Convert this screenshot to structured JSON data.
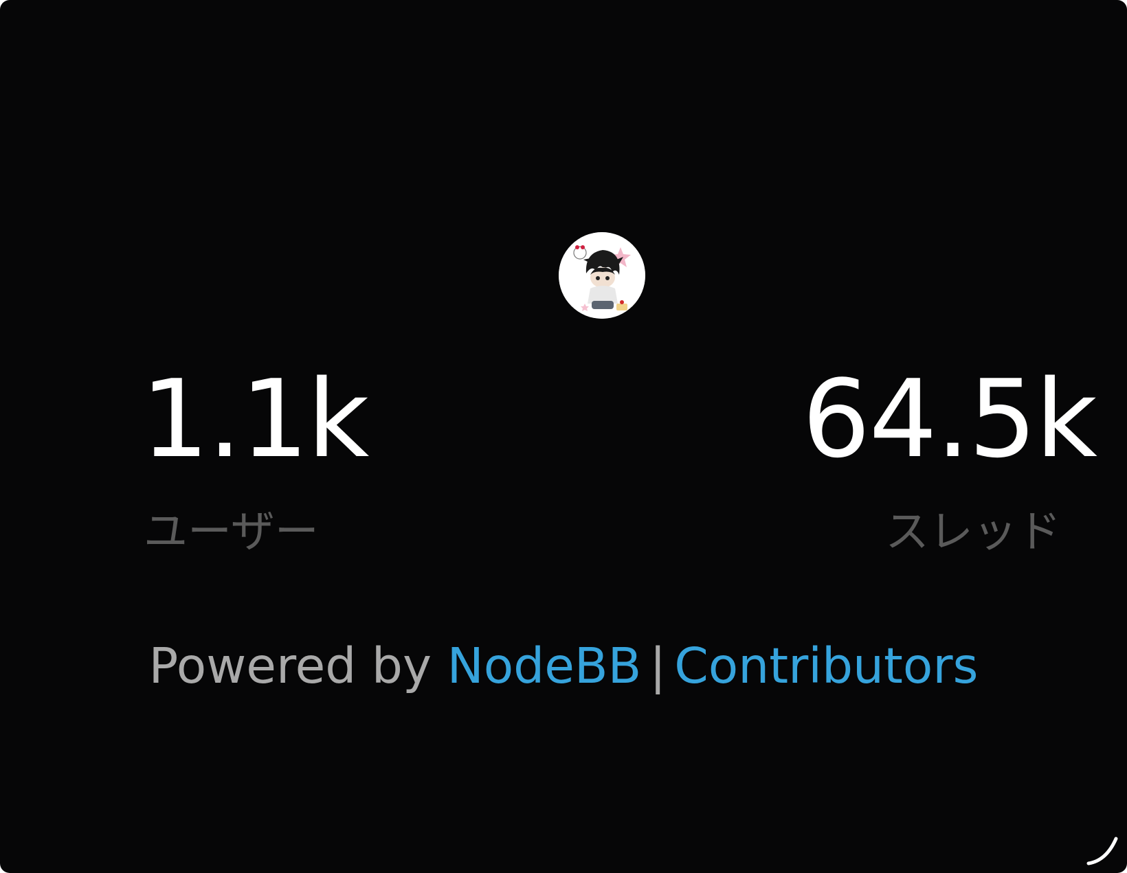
{
  "stats": {
    "users": {
      "value": "1.1k",
      "label": "ユーザー"
    },
    "threads": {
      "value": "64.5k",
      "label": "スレッド"
    }
  },
  "footer": {
    "powered_by": "Powered by",
    "nodebb_link": "NodeBB",
    "separator": "|",
    "contributors_link": "Contributors"
  },
  "colors": {
    "background": "#060607",
    "stat_value": "#ffffff",
    "stat_label": "#5a5a5a",
    "footer_text": "#a9a9a9",
    "link": "#36a3dc"
  },
  "icons": {
    "avatar": "forum-logo-avatar",
    "resize": "resize-handle-icon"
  }
}
